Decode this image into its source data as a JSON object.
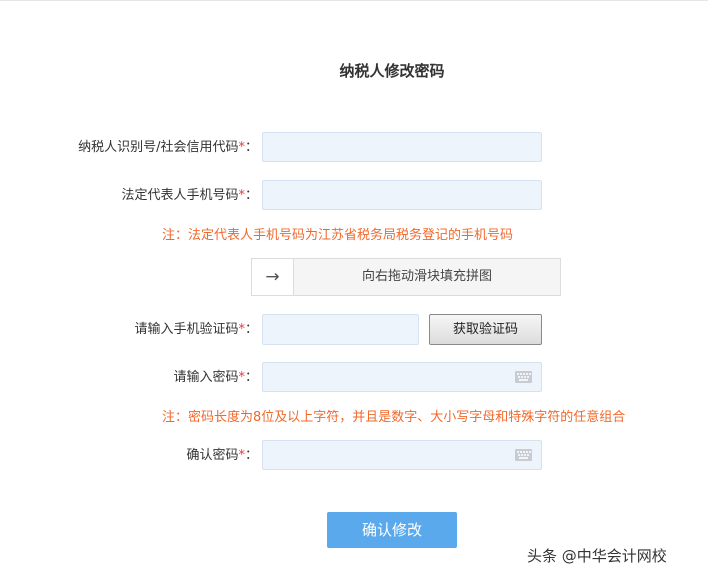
{
  "title": "纳税人修改密码",
  "form": {
    "taxpayer_id_label": "纳税人识别号/社会信用代码",
    "phone_label": "法定代表人手机号码",
    "phone_note": "注：法定代表人手机号码为江苏省税务局税务登记的手机号码",
    "slider_arrow": "→",
    "slider_text": "向右拖动滑块填充拼图",
    "sms_code_label": "请输入手机验证码",
    "get_code_button": "获取验证码",
    "password_label": "请输入密码",
    "password_note": "注：密码长度为8位及以上字符，并且是数字、大小写字母和特殊字符的任意组合",
    "confirm_label": "确认密码",
    "required_mark": "*",
    "colon": "：",
    "submit_button": "确认修改"
  },
  "watermark": {
    "text": "头条 @中华会计网校"
  },
  "colors": {
    "accent_button": "#5aa9ec",
    "note_text": "#f0692c",
    "required_star": "#e4393c",
    "input_bg": "#eef4fc"
  },
  "icons": {
    "slider_handle": "arrow-right-icon",
    "password_fields": "keyboard-icon"
  }
}
